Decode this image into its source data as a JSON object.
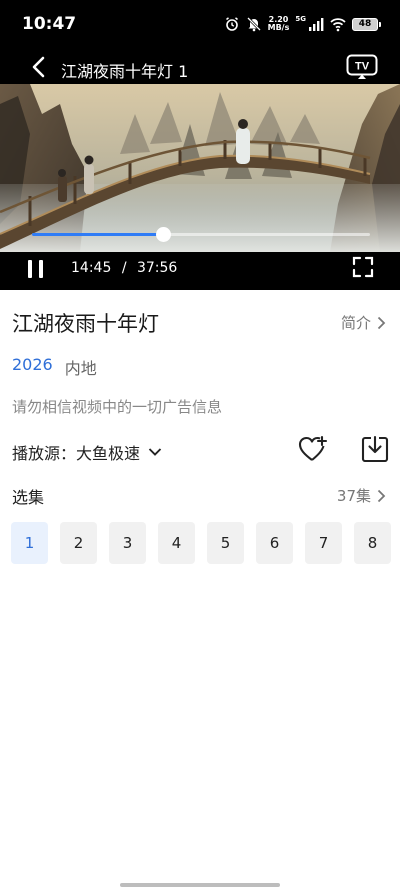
{
  "status": {
    "time": "10:47",
    "net_speed_value": "2.20",
    "net_speed_unit": "MB/s",
    "signal_label": "5G",
    "battery": "48"
  },
  "player": {
    "title": "江湖夜雨十年灯 1",
    "tv_label": "TV",
    "current_time": "14:45",
    "separator": "/",
    "duration": "37:56",
    "progress": 0.389,
    "accent_color": "#2f7cf6"
  },
  "info": {
    "title": "江湖夜雨十年灯",
    "intro_label": "简介",
    "year": "2026",
    "region": "内地",
    "notice": "请勿相信视频中的一切广告信息",
    "source_label": "播放源：",
    "source_value": "大鱼极速"
  },
  "episodes": {
    "heading": "选集",
    "count_label": "37集",
    "items": [
      "1",
      "2",
      "3",
      "4",
      "5",
      "6",
      "7",
      "8"
    ],
    "selected": "1"
  },
  "icons": [
    "alarm-icon",
    "mute-icon",
    "signal-icon",
    "wifi-icon",
    "battery-icon",
    "back-icon",
    "tv-cast-icon",
    "pause-icon",
    "fullscreen-icon",
    "chevron-right-icon",
    "chevron-down-icon",
    "heart-add-icon",
    "download-icon"
  ]
}
